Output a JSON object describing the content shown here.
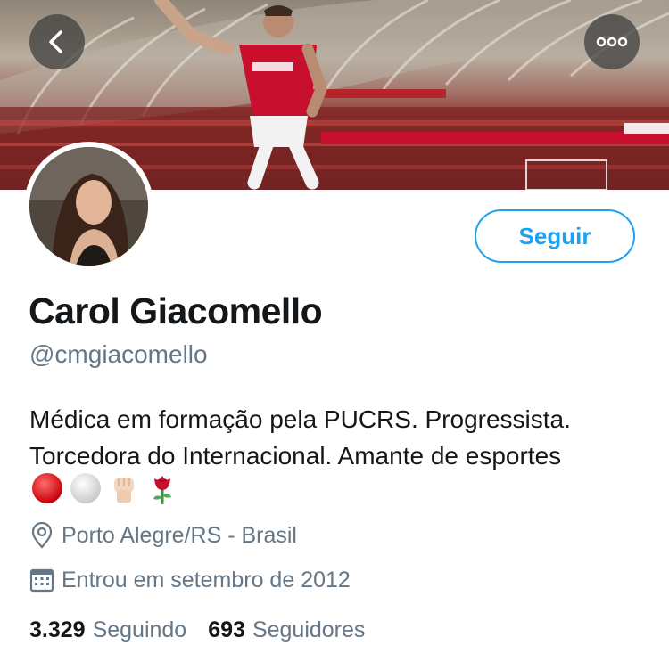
{
  "header": {
    "back_icon": "chevron-left-icon",
    "more_icon": "more-dots-icon",
    "banner_colors": {
      "shirt": "#c8102e",
      "stands": "#8e2e2c",
      "roof": "#a69a8b"
    }
  },
  "profile": {
    "follow_label": "Seguir",
    "name": "Carol Giacomello",
    "handle": "@cmgiacomello",
    "bio_line1": "Médica em formação pela PUCRS. Progressista.",
    "bio_line2": "Torcedora do Internacional. Amante de esportes",
    "bio_emojis": [
      "red-circle",
      "white-circle",
      "raised-fist-light-skin",
      "rose"
    ],
    "location": "Porto Alegre/RS - Brasil",
    "joined": "Entrou em setembro de 2012",
    "following_count": "3.329",
    "following_label": "Seguindo",
    "followers_count": "693",
    "followers_label": "Seguidores"
  },
  "colors": {
    "accent": "#1da1f2",
    "secondary_text": "#657786",
    "primary_text": "#14171a"
  }
}
